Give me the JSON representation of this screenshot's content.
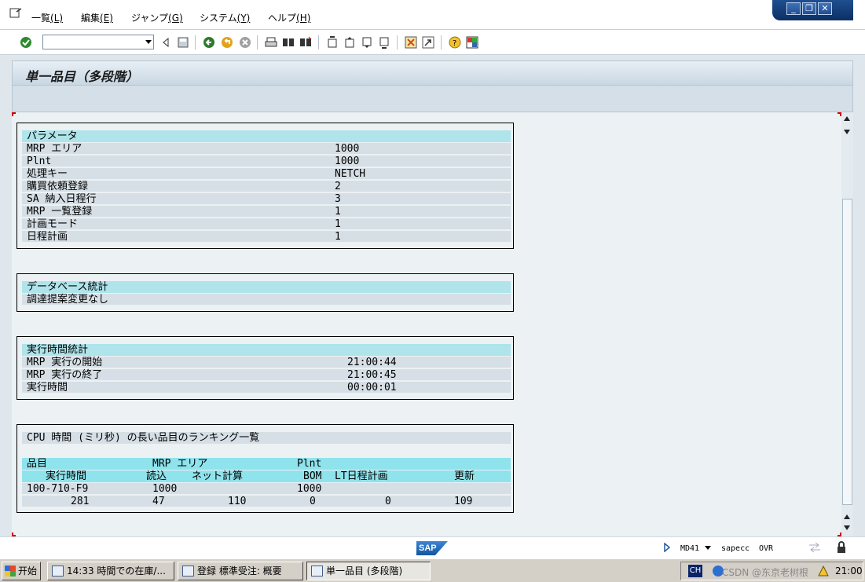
{
  "menu": {
    "items": [
      {
        "label": "一覧",
        "key": "(L)"
      },
      {
        "label": "編集",
        "key": "(E)"
      },
      {
        "label": "ジャンプ",
        "key": "(G)"
      },
      {
        "label": "システム",
        "key": "(Y)"
      },
      {
        "label": "ヘルプ",
        "key": "(H)"
      }
    ]
  },
  "window_controls": {
    "minimize": "_",
    "restore": "❐",
    "close": "✕"
  },
  "toolbar": {
    "icons": [
      "check-icon",
      "back-icon",
      "save-icon",
      "back-arrow-icon",
      "exit-icon",
      "cancel-icon",
      "print-icon",
      "find-icon",
      "find-next-icon",
      "first-page-icon",
      "previous-page-icon",
      "next-page-icon",
      "last-page-icon",
      "create-session-icon",
      "shortcut-icon",
      "help-icon",
      "layout-icon"
    ]
  },
  "title": "単一品目（多段階）",
  "params": {
    "header": "パラメータ",
    "rows": [
      {
        "label": "MRP エリア",
        "value": "1000"
      },
      {
        "label": "Plnt",
        "value": "1000"
      },
      {
        "label": "処理キー",
        "value": "NETCH"
      },
      {
        "label": "購買依頼登録",
        "value": "2"
      },
      {
        "label": "SA 納入日程行",
        "value": "3"
      },
      {
        "label": "MRP 一覧登録",
        "value": "1"
      },
      {
        "label": "計画モード",
        "value": "1"
      },
      {
        "label": "日程計画",
        "value": "1"
      }
    ]
  },
  "db_stats": {
    "header": "データベース統計",
    "rows": [
      {
        "label": "調達提案変更なし",
        "value": ""
      }
    ]
  },
  "runtime_stats": {
    "header": "実行時間統計",
    "rows": [
      {
        "label": "MRP 実行の開始",
        "value": "21:00:44"
      },
      {
        "label": "MRP 実行の終了",
        "value": "21:00:45"
      },
      {
        "label": "実行時間",
        "value": "00:00:01"
      }
    ]
  },
  "ranking": {
    "header": "CPU 時間 (ミリ秒) の長い品目のランキング一覧",
    "col_header_1": {
      "item": "品目",
      "mrp_area": "MRP エリア",
      "plnt": "Plnt"
    },
    "col_header_2": {
      "runtime": "実行時間",
      "read": "読込",
      "net_calc": "ネット計算",
      "bom": "BOM",
      "lt_sched": "LT日程計画",
      "update": "更新"
    },
    "row_1": {
      "item": "100-710-F9",
      "mrp_area": "1000",
      "plnt": "1000"
    },
    "row_2": {
      "runtime": "281",
      "read": "47",
      "net_calc": "110",
      "bom": "0",
      "lt_sched": "0",
      "update": "109"
    }
  },
  "status": {
    "logo": "SAP",
    "transaction": "MD41",
    "system": "sapecc",
    "mode": "OVR"
  },
  "taskbar": {
    "start": "开始",
    "tasks": [
      {
        "label": "14:33 時間での在庫/..."
      },
      {
        "label": "登録 標準受注: 概要"
      },
      {
        "label": "単一品目 (多段階)"
      }
    ],
    "tray_lang": "CH",
    "watermark": "CSDN @东京老树根",
    "clock": "21:00"
  }
}
